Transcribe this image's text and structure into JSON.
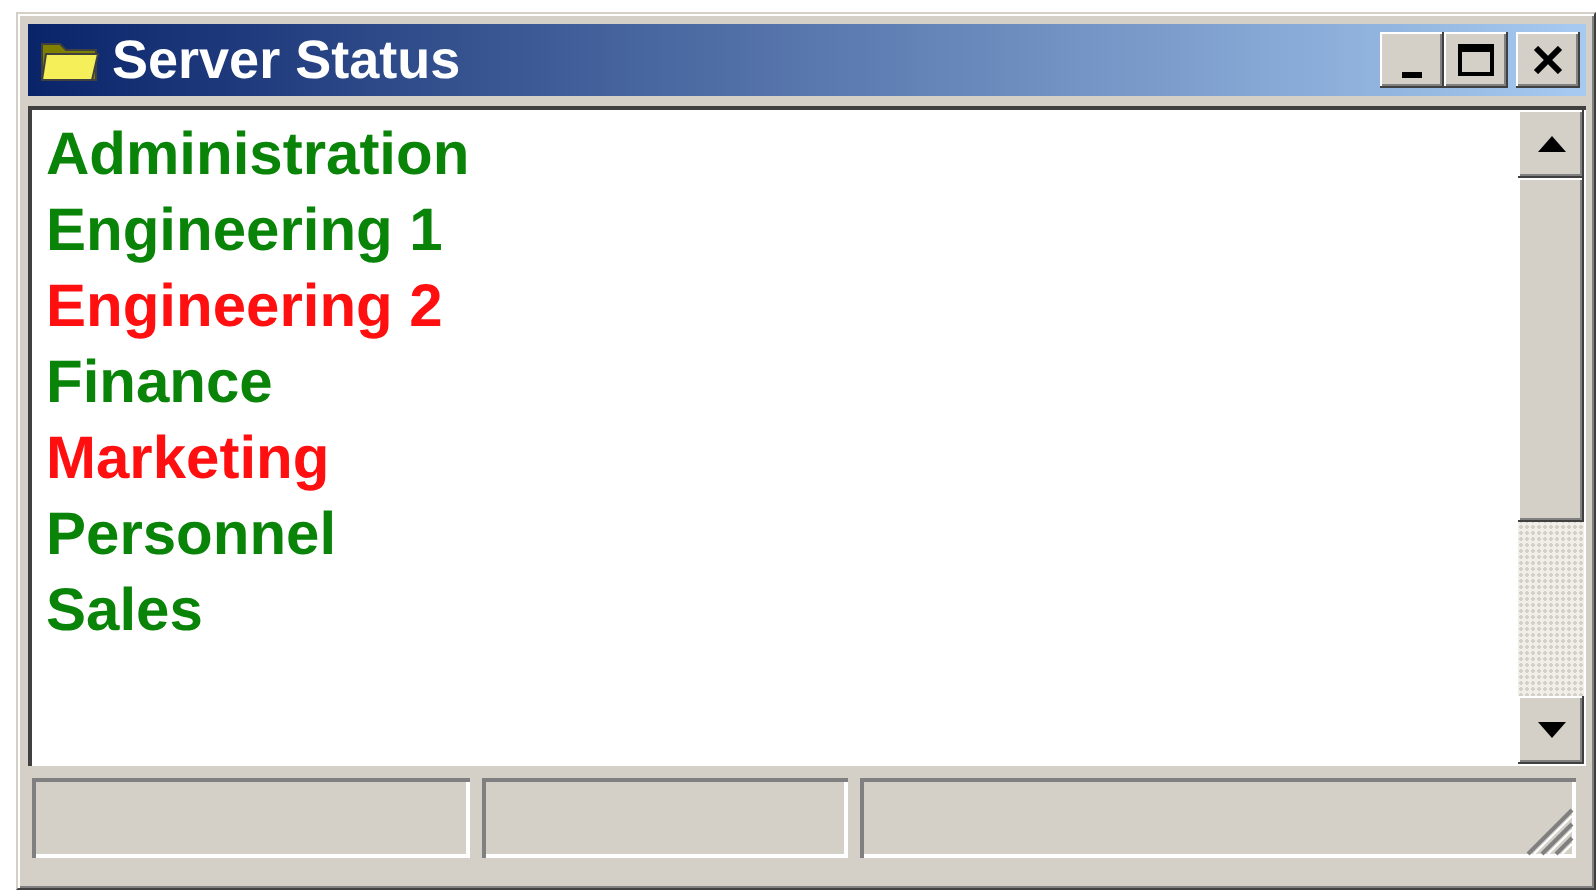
{
  "window": {
    "title": "Server Status"
  },
  "servers": [
    {
      "name": "Administration",
      "color": "#098409"
    },
    {
      "name": "Engineering 1",
      "color": "#098409"
    },
    {
      "name": "Engineering 2",
      "color": "#ff0f0f"
    },
    {
      "name": "Finance",
      "color": "#098409"
    },
    {
      "name": "Marketing",
      "color": "#ff0f0f"
    },
    {
      "name": "Personnel",
      "color": "#098409"
    },
    {
      "name": "Sales",
      "color": "#098409"
    }
  ]
}
